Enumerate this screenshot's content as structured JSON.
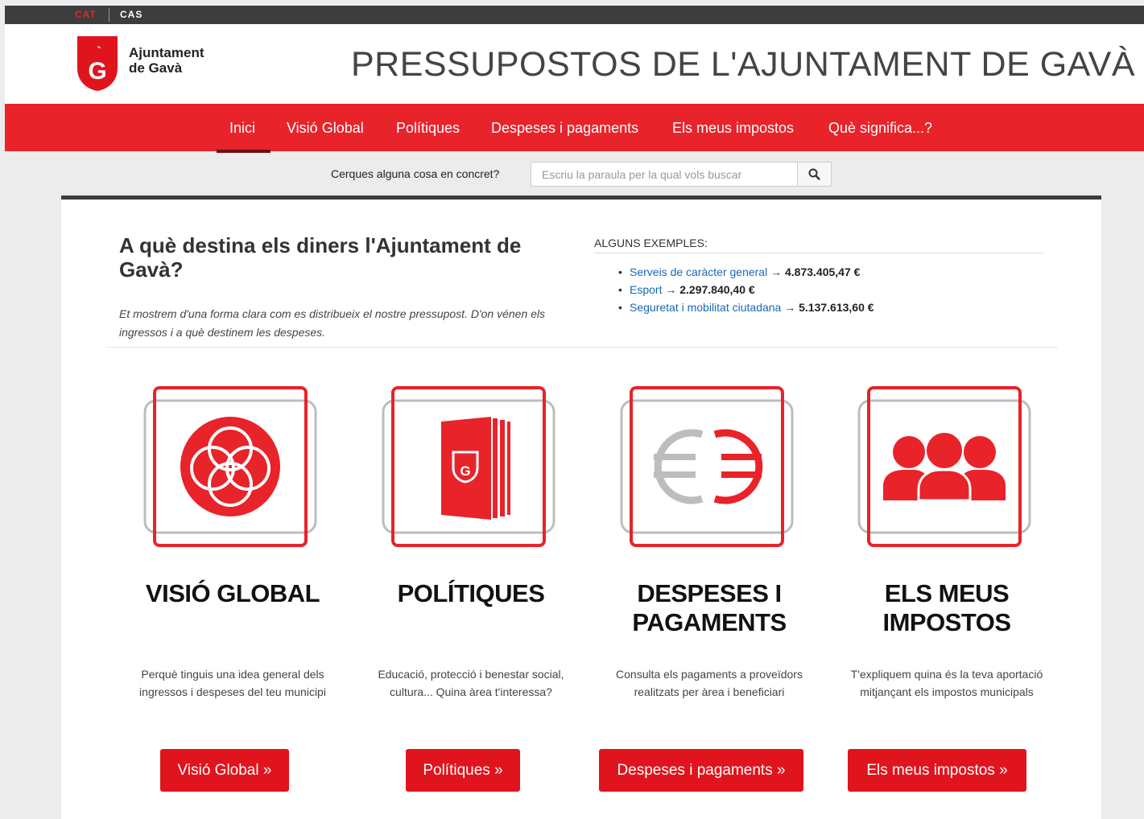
{
  "languages": {
    "cat": "CAT",
    "cas": "CAS"
  },
  "logo": {
    "line1": "Ajuntament",
    "line2": "de Gavà"
  },
  "site_title": "PRESSUPOSTOS DE L'AJUNTAMENT DE GAVÀ",
  "nav": [
    "Inici",
    "Visió Global",
    "Polítiques",
    "Despeses i pagaments",
    "Els meus impostos",
    "Què significa...?"
  ],
  "search": {
    "label": "Cerques alguna cosa en concret?",
    "placeholder": "Escriu la paraula per la qual vols buscar"
  },
  "intro": {
    "title": "A què destina els diners l'Ajuntament de Gavà?",
    "text": "Et mostrem d'una forma clara com es distribueix el nostre pressupost. D'on vénen els ingressos i a què destinem les despeses."
  },
  "examples": {
    "heading": "ALGUNS EXEMPLES:",
    "items": [
      {
        "label": "Serveis de caràcter general",
        "arrow": "→",
        "value": "4.873.405,47 €"
      },
      {
        "label": "Esport",
        "arrow": "→",
        "value": "2.297.840,40 €"
      },
      {
        "label": "Seguretat i mobilitat ciutadana",
        "arrow": "→",
        "value": "5.137.613,60 €"
      }
    ]
  },
  "cards": [
    {
      "title": "VISIÓ GLOBAL",
      "text": "Perquè tinguis una idea general dels ingressos i despeses del teu municipi",
      "button": "Visió Global »",
      "icon": "circles-icon"
    },
    {
      "title": "POLÍTIQUES",
      "text": "Educació, protecció i benestar social, cultura... Quina àrea t'interessa?",
      "button": "Polítiques »",
      "icon": "book-icon"
    },
    {
      "title": "DESPESES I PAGAMENTS",
      "text": "Consulta els pagaments a proveïdors realitzats per àrea i beneficiari",
      "button": "Despeses i pagaments »",
      "icon": "euro-icon"
    },
    {
      "title": "ELS MEUS IMPOSTOS",
      "text": "T'expliquem quina és la teva aportació mitjançant els impostos municipals",
      "button": "Els meus impostos »",
      "icon": "people-icon"
    }
  ],
  "colors": {
    "brand_red": "#e8232a",
    "dark_bar": "#3d3d3d",
    "link_blue": "#1a67b6"
  }
}
